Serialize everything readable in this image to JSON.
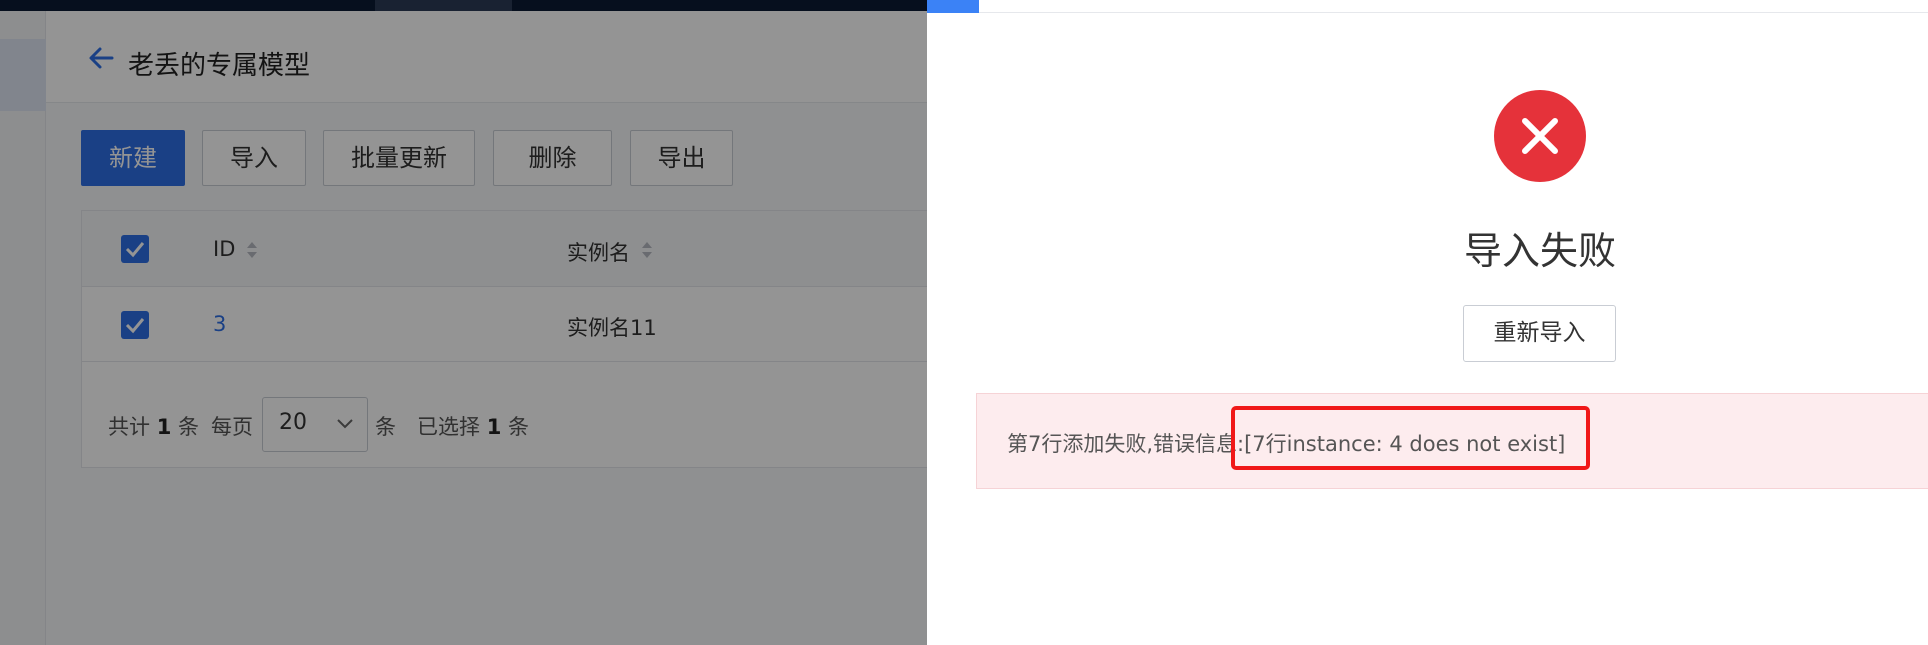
{
  "header": {
    "back_icon": "arrow-left-icon",
    "title": "老丢的专属模型"
  },
  "toolbar": {
    "new_label": "新建",
    "import_label": "导入",
    "batch_update_label": "批量更新",
    "delete_label": "删除",
    "export_label": "导出"
  },
  "table": {
    "columns": [
      "ID",
      "实例名"
    ],
    "rows": [
      {
        "id": "3",
        "name": "实例名11",
        "checked": true
      }
    ]
  },
  "pagination": {
    "total_prefix": "共计",
    "total_count": "1",
    "total_suffix": "条",
    "per_page_prefix": "每页",
    "page_size": "20",
    "per_page_suffix": "条",
    "selected_prefix": "已选择",
    "selected_count": "1",
    "selected_suffix": "条"
  },
  "drawer": {
    "status_icon": "close-circle-icon",
    "title": "导入失败",
    "reimport_label": "重新导入",
    "error_message": "第7行添加失败,错误信息:[7行instance: 4 does not exist]"
  },
  "colors": {
    "primary": "#2d6fe5",
    "error": "#e5323a",
    "error_bg": "#fdecee",
    "highlight": "#f01818"
  }
}
